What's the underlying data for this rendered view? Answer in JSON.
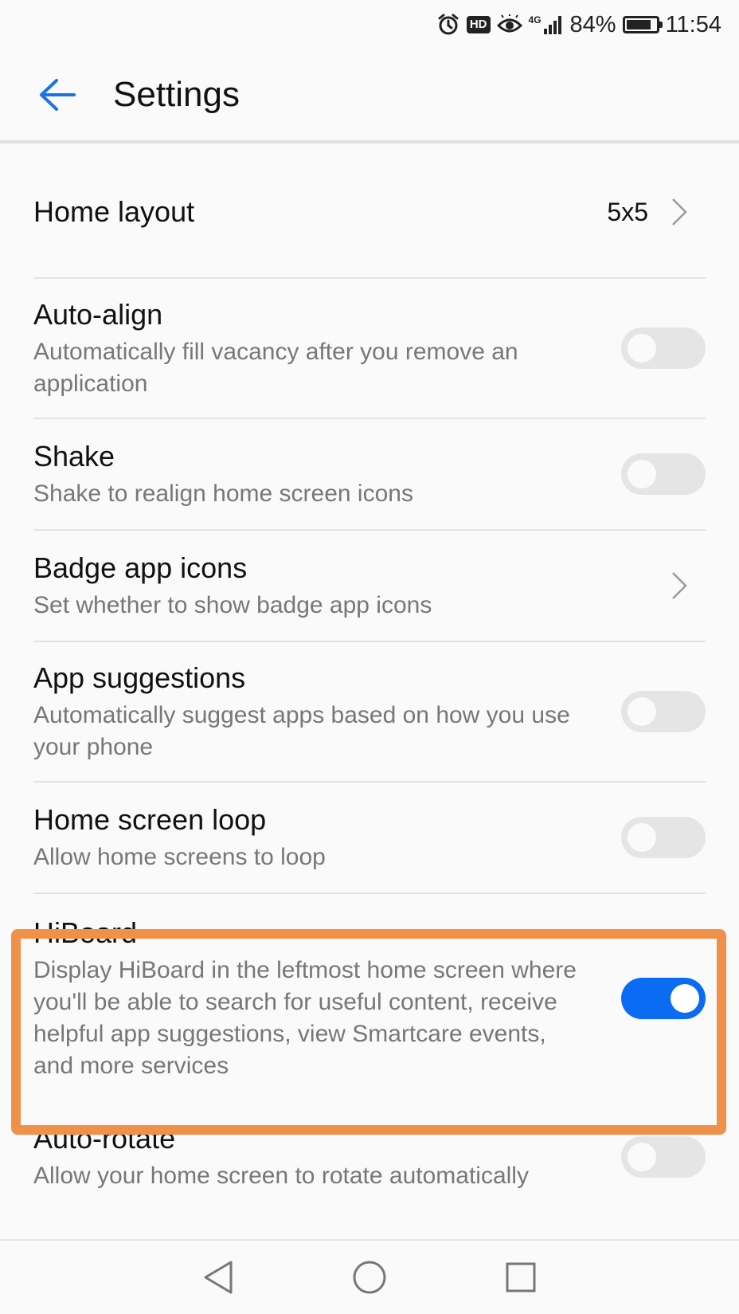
{
  "status_bar": {
    "icons": [
      "alarm-icon",
      "hd-icon",
      "eye-icon",
      "signal-4g-icon",
      "battery-icon"
    ],
    "hd_label": "HD",
    "network_label": "4G",
    "battery_percent": "84%",
    "battery_level": 0.84,
    "time": "11:54"
  },
  "app_bar": {
    "back_icon": "back-arrow-icon",
    "title": "Settings",
    "accent_color": "#1a73e8"
  },
  "settings": {
    "home_layout": {
      "title": "Home layout",
      "value": "5x5"
    },
    "auto_align": {
      "title": "Auto-align",
      "subtitle": "Automatically fill vacancy after you remove an application",
      "enabled": false
    },
    "shake": {
      "title": "Shake",
      "subtitle": "Shake to realign home screen icons",
      "enabled": false
    },
    "badge_app_icons": {
      "title": "Badge app icons",
      "subtitle": "Set whether to show badge app icons"
    },
    "app_suggestions": {
      "title": "App suggestions",
      "subtitle": "Automatically suggest apps based on how you use your phone",
      "enabled": false
    },
    "home_screen_loop": {
      "title": "Home screen loop",
      "subtitle": "Allow home screens to loop",
      "enabled": false
    },
    "hiboard": {
      "title": "HiBoard",
      "subtitle": "Display HiBoard in the leftmost home screen where you'll be able to search for useful content, receive helpful app suggestions, view Smartcare events, and more services",
      "enabled": true
    },
    "auto_rotate": {
      "title": "Auto-rotate",
      "subtitle": "Allow your home screen to rotate automatically",
      "enabled": false
    }
  },
  "colors": {
    "switch_on": "#0a6cf2",
    "switch_off": "#e5e5e5",
    "highlight": "#f0914a"
  },
  "nav_bar": {
    "icons": [
      "nav-back-icon",
      "nav-home-icon",
      "nav-recents-icon"
    ]
  }
}
